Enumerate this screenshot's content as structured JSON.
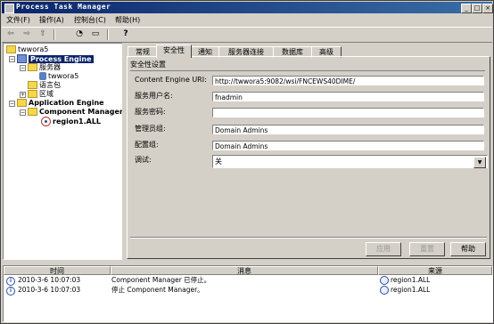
{
  "window": {
    "title": "Process Task Manager"
  },
  "menu": [
    "文件(F)",
    "操作(A)",
    "控制台(C)",
    "帮助(H)"
  ],
  "toolbar": {
    "help_glyph": "?"
  },
  "tree": {
    "root": "twwora5",
    "process_engine": "Process Engine",
    "servers": "服务器",
    "server_node": "twwora5",
    "lang_pack": "语言包",
    "region": "区域",
    "application_engine": "Application Engine",
    "component_manager": "Component Manager",
    "region_node": "region1.ALL"
  },
  "tabs": [
    "常规",
    "安全性",
    "通知",
    "服务器连接",
    "数据库",
    "高级"
  ],
  "active_tab": 1,
  "security": {
    "section_title": "安全性设置",
    "fields": [
      {
        "label": "Content Engine URI:",
        "value": "http://twwora5:9082/wsi/FNCEWS40DIME/"
      },
      {
        "label": "服务用户名:",
        "value": "fnadmin"
      },
      {
        "label": "服务密码:",
        "value": ""
      },
      {
        "label": "管理员组:",
        "value": "Domain Admins"
      },
      {
        "label": "配置组:",
        "value": "Domain Admins"
      }
    ],
    "debug_label": "调试:",
    "debug_value": "关"
  },
  "buttons": {
    "apply": "应用",
    "reset": "重置",
    "help": "帮助"
  },
  "log": {
    "headers": {
      "time": "时间",
      "message": "消息",
      "source": "来源"
    },
    "rows": [
      {
        "time": "2010-3-6 10:07:03",
        "message": "Component Manager 已停止。",
        "source": "region1.ALL"
      },
      {
        "time": "2010-3-6 10:07:03",
        "message": "停止 Component Manager。",
        "source": "region1.ALL"
      }
    ]
  },
  "colors": {
    "titlebar": "#0a246a",
    "selection": "#0a246a",
    "window_bg": "#d4d0c8"
  }
}
